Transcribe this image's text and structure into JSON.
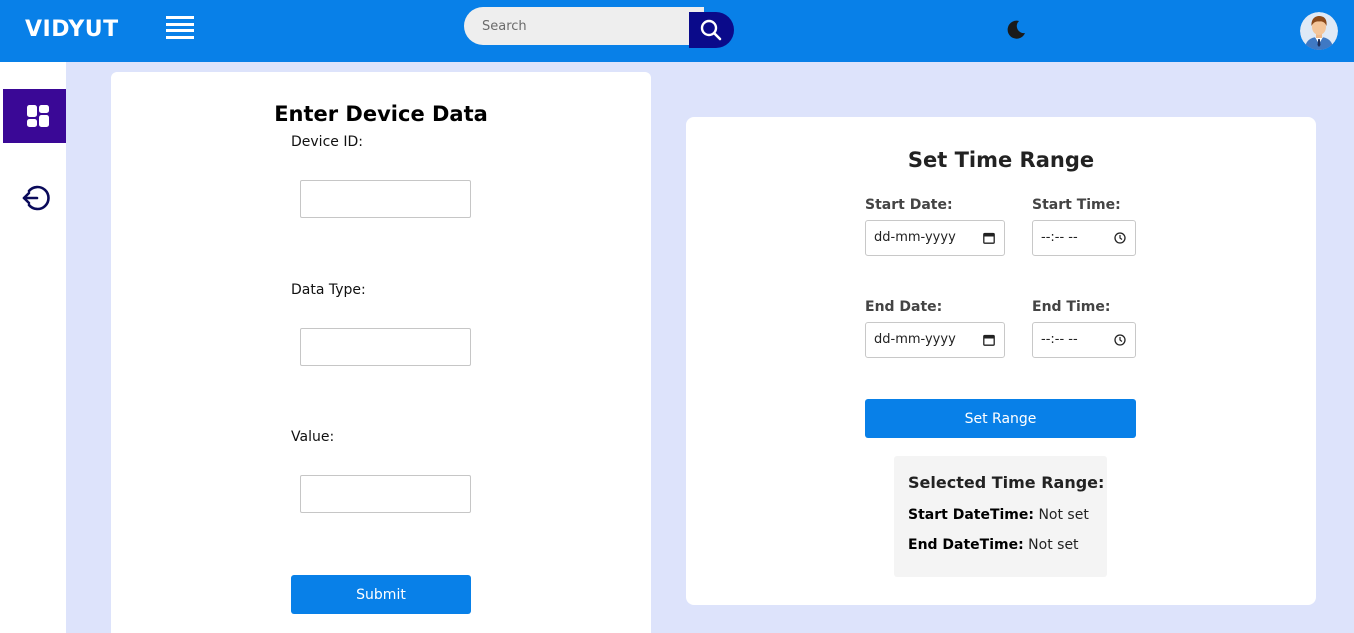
{
  "header": {
    "brand": "VIDYUT",
    "search_placeholder": "Search"
  },
  "icons": {
    "menu": "hamburger-icon",
    "search": "search-icon",
    "theme": "moon-icon",
    "avatar": "user-avatar",
    "dashboard": "dashboard-icon",
    "logout": "logout-icon",
    "calendar": "calendar-icon",
    "clock": "clock-icon"
  },
  "colors": {
    "primary": "#0880e8",
    "sidebar_active": "#3a0896",
    "search_button": "#0a0a8a",
    "background": "#dde3fb"
  },
  "device_form": {
    "title": "Enter Device Data",
    "fields": [
      {
        "label": "Device ID:",
        "value": ""
      },
      {
        "label": "Data Type:",
        "value": ""
      },
      {
        "label": "Value:",
        "value": ""
      }
    ],
    "submit_label": "Submit"
  },
  "time_range": {
    "title": "Set Time Range",
    "start_date_label": "Start Date:",
    "start_date_value": "dd-mm-yyyy",
    "start_time_label": "Start Time:",
    "start_time_value": "--:-- --",
    "end_date_label": "End Date:",
    "end_date_value": "dd-mm-yyyy",
    "end_time_label": "End Time:",
    "end_time_value": "--:-- --",
    "set_label": "Set Range",
    "selected": {
      "heading": "Selected Time Range:",
      "start_label": "Start DateTime:",
      "start_value": "Not set",
      "end_label": "End DateTime:",
      "end_value": "Not set"
    }
  }
}
